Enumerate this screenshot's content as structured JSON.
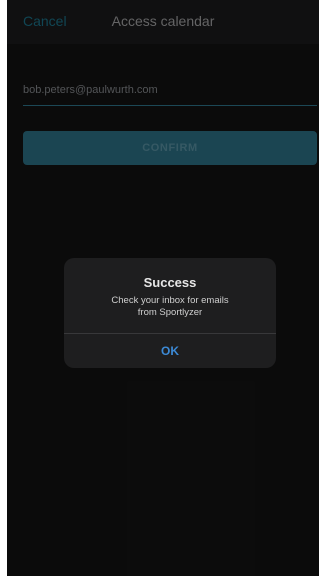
{
  "nav": {
    "cancel_label": "Cancel",
    "title": "Access calendar"
  },
  "form": {
    "email_value": "bob.peters@paulwurth.com",
    "confirm_label": "CONFIRM"
  },
  "dialog": {
    "title": "Success",
    "message_line1": "Check your inbox for emails",
    "message_line2": "from Sportlyzer",
    "ok_label": "OK"
  },
  "colors": {
    "accent": "#2a6a7e",
    "link": "#3c8ad6",
    "background": "#121212"
  }
}
